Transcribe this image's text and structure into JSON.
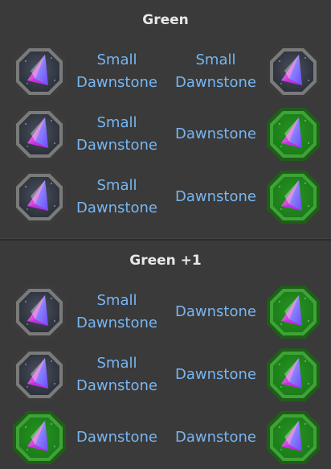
{
  "sections": [
    {
      "title": "Green",
      "rows": [
        {
          "left_icon": "gray-frame-dawnstone-icon",
          "from": "Small Dawnstone",
          "to": "Small Dawnstone",
          "right_icon": "gray-frame-dawnstone-icon"
        },
        {
          "left_icon": "gray-frame-dawnstone-icon",
          "from": "Small Dawnstone",
          "to": "Dawnstone",
          "right_icon": "green-frame-dawnstone-icon"
        },
        {
          "left_icon": "gray-frame-dawnstone-icon",
          "from": "Small Dawnstone",
          "to": "Dawnstone",
          "right_icon": "green-frame-dawnstone-icon"
        }
      ]
    },
    {
      "title": "Green +1",
      "rows": [
        {
          "left_icon": "gray-frame-dawnstone-icon",
          "from": "Small Dawnstone",
          "to": "Dawnstone",
          "right_icon": "green-frame-dawnstone-icon"
        },
        {
          "left_icon": "gray-frame-dawnstone-icon",
          "from": "Small Dawnstone",
          "to": "Dawnstone",
          "right_icon": "green-frame-dawnstone-icon"
        },
        {
          "left_icon": "green-frame-dawnstone-icon",
          "from": "Dawnstone",
          "to": "Dawnstone",
          "right_icon": "green-frame-dawnstone-icon"
        }
      ]
    }
  ],
  "colors": {
    "background": "#3a3a3a",
    "label_text": "#78b6f2",
    "title_text": "#e8e8e8",
    "gray_frame": "#5a5a5a",
    "green_frame": "#2f8a26"
  }
}
